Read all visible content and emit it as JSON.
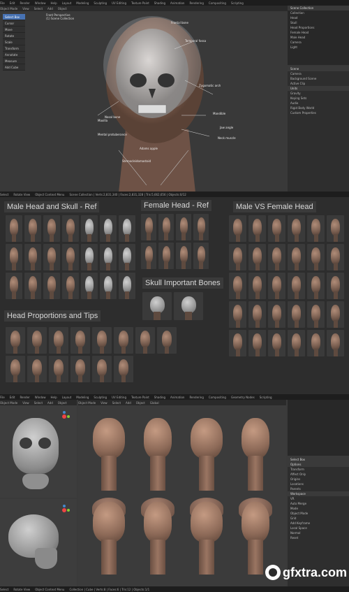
{
  "top": {
    "menubar": [
      "Layout",
      "Modeling",
      "Sculpting",
      "UV Editing",
      "Texture Paint",
      "Shading",
      "Animation",
      "Rendering",
      "Compositing",
      "Scripting"
    ],
    "menus": [
      "File",
      "Edit",
      "Render",
      "Window",
      "Help"
    ],
    "header": [
      "Object Mode",
      "View",
      "Select",
      "Add",
      "Object"
    ],
    "viewport_label": "Front Perspective",
    "viewport_sub": "(1) Scene Collection",
    "tools": [
      "Select Box",
      "Cursor",
      "Move",
      "Rotate",
      "Scale",
      "Transform",
      "Annotate",
      "Measure",
      "Add Cube"
    ],
    "annotations": [
      "Frontal bone",
      "Temporal fossa",
      "Zygomatic arch",
      "Nasal bone",
      "Maxilla",
      "Mandible",
      "Jaw angle",
      "Mental protuberance",
      "Sternocleidomastoid",
      "Neck muscle",
      "Adams apple"
    ],
    "outliner": [
      "Scene Collection",
      "Collection",
      "Head",
      "Skull",
      "Head Proportions",
      "Female Head",
      "Male Head",
      "Camera",
      "Light"
    ],
    "properties": [
      "Scene",
      "Camera",
      "Background Scene",
      "Active Clip",
      "Units",
      "Gravity",
      "Keying Sets",
      "Audio",
      "Rigid Body World",
      "Custom Properties"
    ],
    "status": [
      "Select",
      "Rotate View",
      "Object Context Menu",
      "Scene Collection | Verts:2,831,340 | Faces:2,831,328 | Tris:5,662,656 | Objects:0/12"
    ]
  },
  "board": {
    "titles": {
      "male": "Male Head and Skull - Ref",
      "female": "Female Head - Ref",
      "compare": "Male VS Female Head",
      "skull": "Skull Important Bones",
      "proportions": "Head Proportions and Tips"
    }
  },
  "bottom": {
    "menubar": [
      "Layout",
      "Modeling",
      "Sculpting",
      "UV Editing",
      "Texture Paint",
      "Shading",
      "Animation",
      "Rendering",
      "Compositing",
      "Geometry Nodes",
      "Scripting"
    ],
    "menus": [
      "File",
      "Edit",
      "Render",
      "Window",
      "Help"
    ],
    "header_left": [
      "Object Mode",
      "View",
      "Select",
      "Add",
      "Object"
    ],
    "header_mid": [
      "Object Mode",
      "View",
      "Select",
      "Add",
      "Object",
      "Global"
    ],
    "properties": [
      "Select Box",
      "Options",
      "Transform",
      "Affect Only",
      "Origins",
      "Locations",
      "Parents",
      "Workspace",
      "VR",
      "Auto Merge",
      "Mode",
      "Object Mode",
      "Grid",
      "Add Keyframe",
      "Local Space",
      "Normal",
      "Reset"
    ],
    "status": [
      "Select",
      "Rotate View",
      "Object Context Menu",
      "Collection | Cube | Verts:8 | Faces:6 | Tris:12 | Objects:1/1"
    ]
  },
  "watermark": "gfxtra.com",
  "colors": {
    "accent": "#4772b3",
    "skin": "#8d6a58",
    "bg": "#2b2b2b"
  }
}
